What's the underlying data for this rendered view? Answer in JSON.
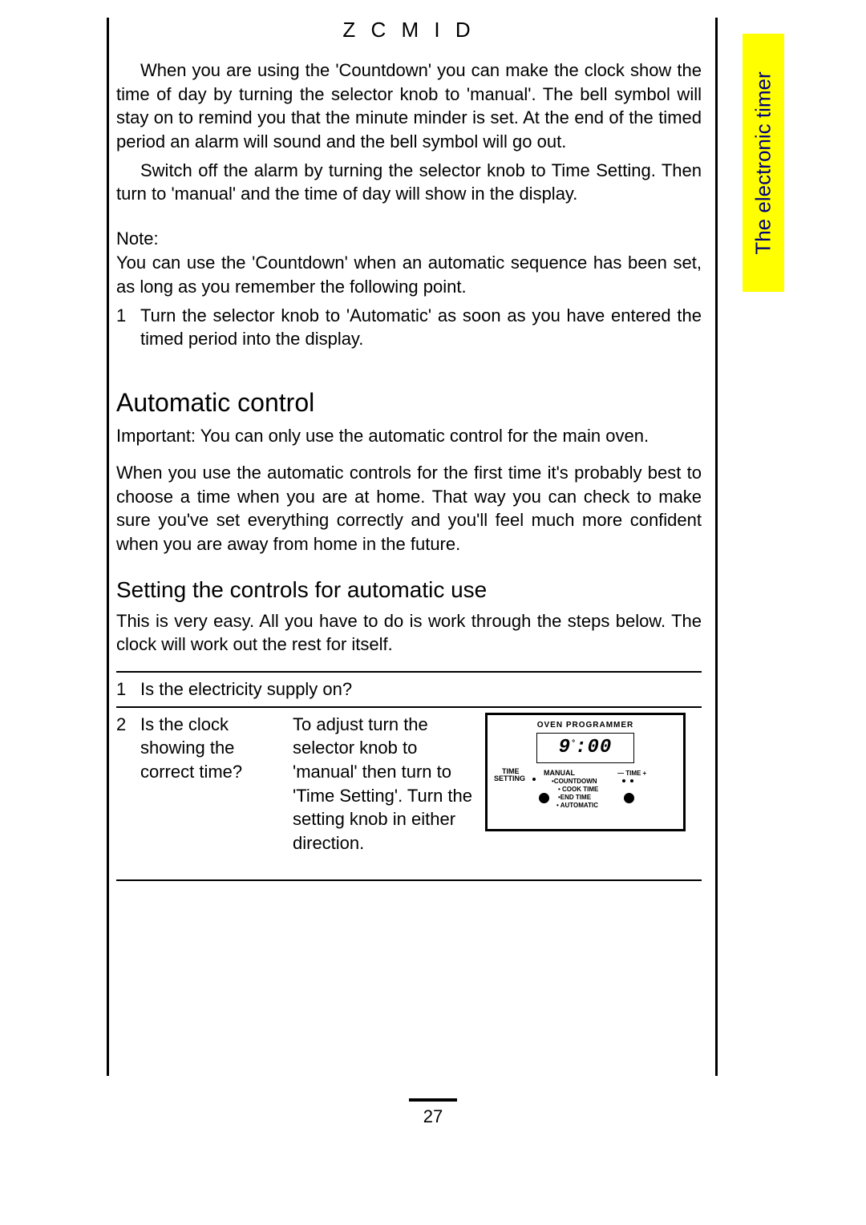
{
  "header": "Z C M  I D",
  "sideTab": "The electronic timer",
  "p1": "When you are using the 'Countdown' you can make the clock show the time of day by turning the selector knob to 'manual'. The bell symbol will stay on to remind you that the minute minder is set. At the end of the timed period an alarm will sound and the bell symbol will go out.",
  "p2": "Switch off the alarm by turning the selector knob to Time Setting. Then turn to 'manual' and the time of day will show in the display.",
  "noteLabel": "Note:",
  "noteBody": "You can use the 'Countdown' when an automatic sequence has been set, as long as you remember the following point.",
  "noteItemNum": "1",
  "noteItem": "Turn the selector knob to 'Automatic' as soon as you have entered the timed period into the display.",
  "h2": "Automatic control",
  "importantLabel": "Important:",
  "importantBody": " You can only use the automatic control for the main oven.",
  "p3": "When you use the automatic controls for the first time it's probably best to choose a time when you are at home. That way you can check to make sure you've set everything correctly and you'll feel much more confident when you are away from home in the future.",
  "h3": "Setting the controls for automatic use",
  "p4": "This is very easy. All you have to do is work through the steps below. The clock will work out the rest for itself.",
  "step1Num": "1",
  "step1": "Is the electricity supply on?",
  "step2Num": "2",
  "step2Q": "Is the clock showing the correct time?",
  "step2A": "To adjust turn the selector knob  to 'manual' then turn to 'Time Setting'. Turn the setting knob in either direction.",
  "diag": {
    "title": "OVEN  PROGRAMMER",
    "time": "9",
    "time2": "00",
    "timeSetting": "TIME",
    "settingWord": "SETTING",
    "manual": "MANUAL",
    "countdown": "•COUNTDOWN",
    "cooktime": "• COOK TIME",
    "endtime": "•END TIME",
    "automatic": "• AUTOMATIC",
    "minus": "— TIME +"
  },
  "pageNumber": "27"
}
